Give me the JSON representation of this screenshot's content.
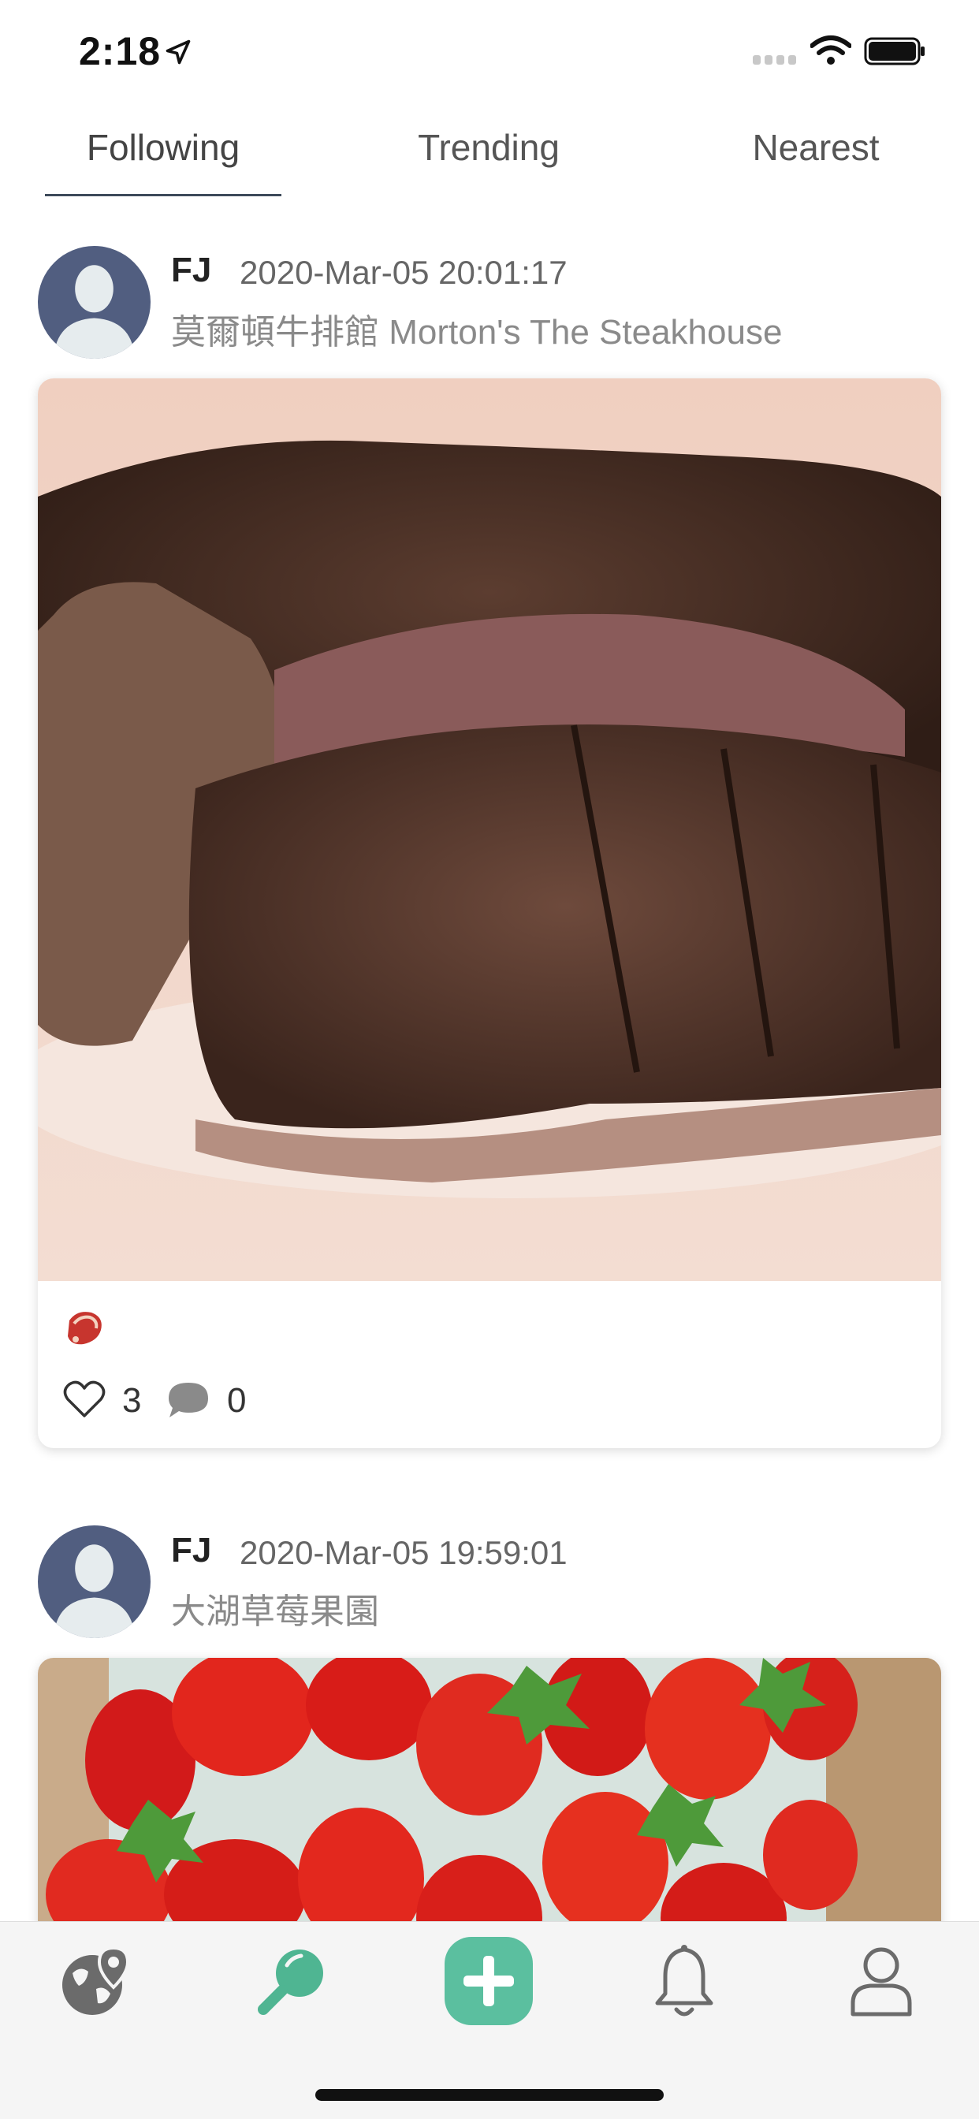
{
  "status": {
    "time": "2:18"
  },
  "tabs": [
    {
      "label": "Following",
      "active": true
    },
    {
      "label": "Trending",
      "active": false
    },
    {
      "label": "Nearest",
      "active": false
    }
  ],
  "posts": [
    {
      "author": "FJ",
      "timestamp": "2020-Mar-05 20:01:17",
      "place": "莫爾頓牛排館 Morton's The Steakhouse",
      "emoji": "meat-icon",
      "likes": "3",
      "comments": "0"
    },
    {
      "author": "FJ",
      "timestamp": "2020-Mar-05 19:59:01",
      "place": "大湖草莓果園"
    }
  ],
  "tabbar": {
    "items": [
      "map-globe-icon",
      "search-icon",
      "add-post-icon",
      "bell-icon",
      "profile-icon"
    ],
    "accent": "#5bbf9f"
  }
}
